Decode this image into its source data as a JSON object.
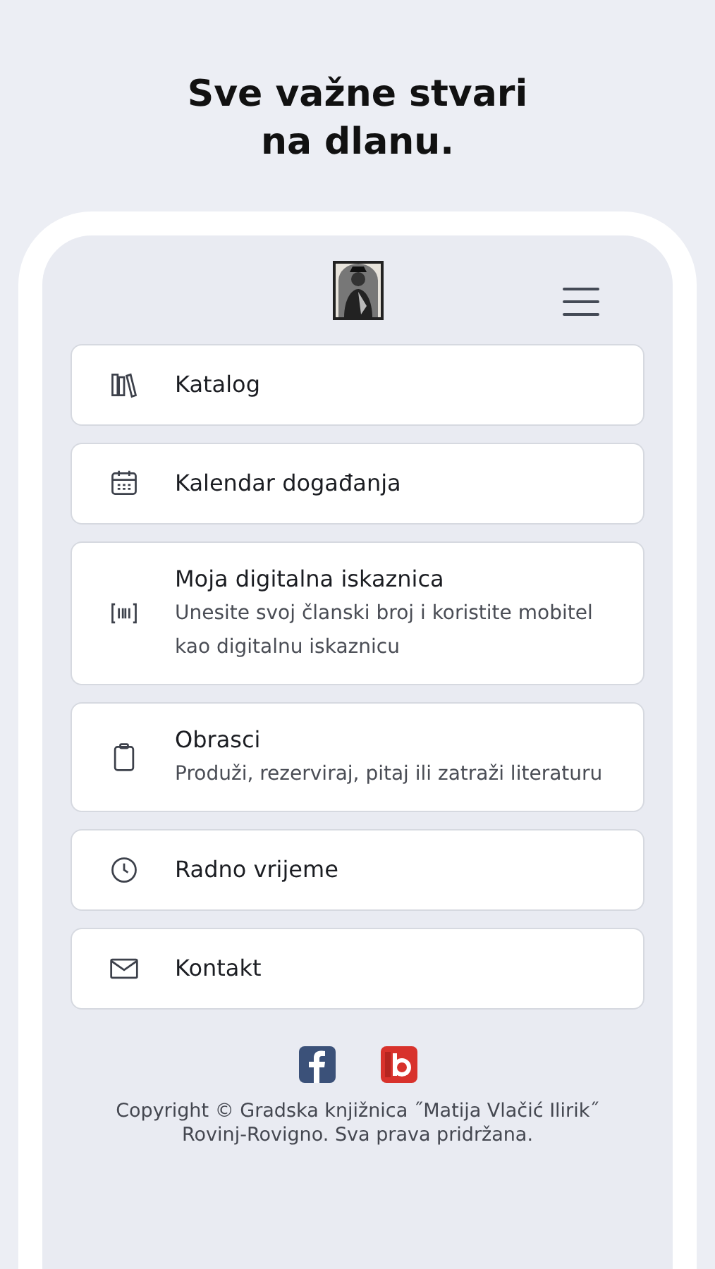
{
  "headline": [
    "Sve važne stvari",
    "na dlanu."
  ],
  "menu_items": [
    {
      "kind": "books",
      "title": "Katalog"
    },
    {
      "kind": "calendar",
      "title": "Kalendar događanja"
    },
    {
      "kind": "barcode",
      "title": "Moja digitalna iskaznica",
      "subtitle": "Unesite svoj članski broj i koristite mobitel kao digitalnu iskaznicu"
    },
    {
      "kind": "clipboard",
      "title": "Obrasci",
      "subtitle": "Produži, rezerviraj, pitaj ili zatraži literaturu"
    },
    {
      "kind": "clock",
      "title": "Radno vrijeme"
    },
    {
      "kind": "mail",
      "title": "Kontakt"
    }
  ],
  "social": [
    {
      "kind": "facebook"
    },
    {
      "kind": "blog"
    }
  ],
  "copyright": [
    "Copyright © Gradska knjižnica ˝Matija Vlačić Ilirik˝",
    "Rovinj-Rovigno. Sva prava pridržana."
  ]
}
